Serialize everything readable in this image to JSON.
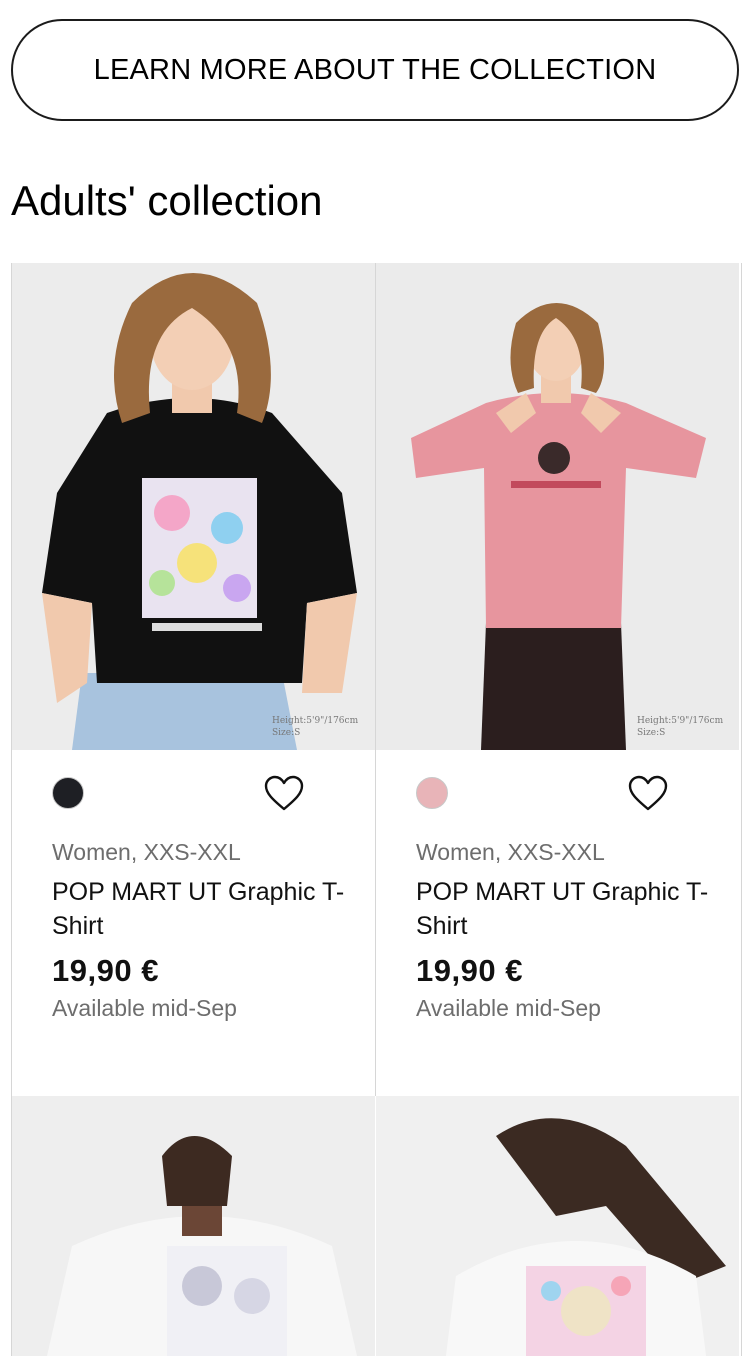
{
  "cta": {
    "label": "LEARN MORE ABOUT THE COLLECTION"
  },
  "section": {
    "title": "Adults' collection"
  },
  "products": [
    {
      "color_swatch": "#1e1f24",
      "image_caption_height": "Height:5'9\"/176cm",
      "image_caption_size": "Size:S",
      "gender_size": "Women, XXS-XXL",
      "name": "POP MART UT Graphic T-Shirt",
      "price": "19,90 €",
      "availability": "Available mid-Sep",
      "shirt_color": "#111111",
      "favorite_icon": "heart-icon"
    },
    {
      "color_swatch": "#e8b4b8",
      "image_caption_height": "Height:5'9\"/176cm",
      "image_caption_size": "Size:S",
      "gender_size": "Women, XXS-XXL",
      "name": "POP MART UT Graphic T-Shirt",
      "price": "19,90 €",
      "availability": "Available mid-Sep",
      "shirt_color": "#e7959e",
      "favorite_icon": "heart-icon"
    }
  ]
}
